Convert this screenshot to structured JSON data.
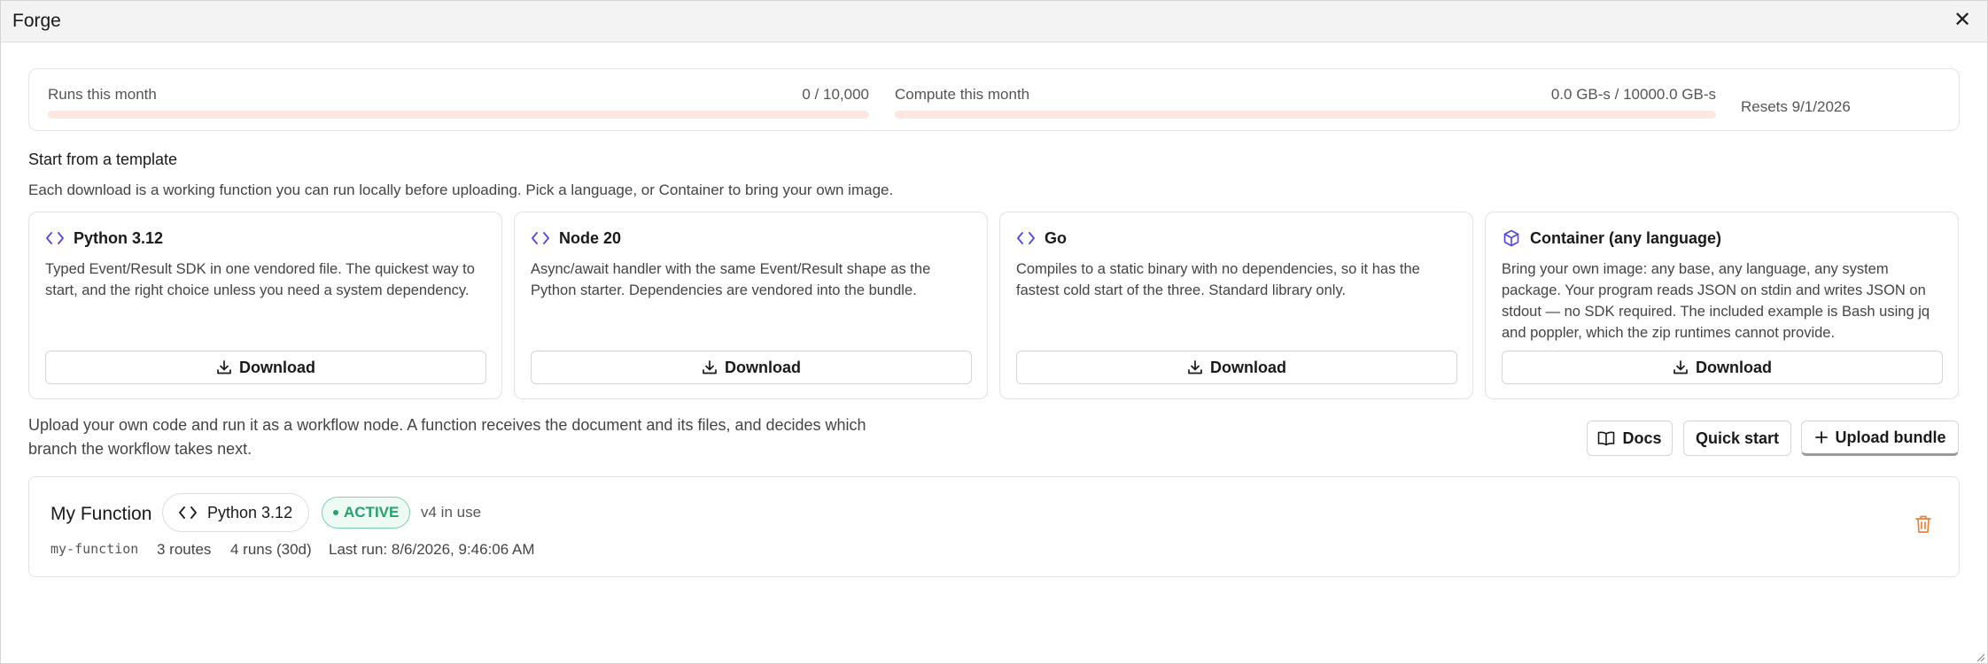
{
  "window": {
    "title": "Forge",
    "close_glyph": "✕"
  },
  "usage": {
    "runs": {
      "label": "Runs this month",
      "value": "0 / 10,000",
      "fraction": 0.0
    },
    "compute": {
      "label": "Compute this month",
      "value": "0.0 GB-s / 10000.0 GB-s",
      "fraction": 0.0
    },
    "reset": "Resets 9/1/2026",
    "colors": {
      "track": "#fde7de",
      "fill": "#f08a5d"
    }
  },
  "templates": {
    "title": "Start from a template",
    "subtitle": "Each download is a working function you can run locally before uploading. Pick a language, or Container to bring your own image.",
    "cards": [
      {
        "icon": "code-icon",
        "name": "Python 3.12",
        "desc": "Typed Event/Result SDK in one vendored file. The quickest way to start, and the right choice unless you need a system dependency.",
        "button": "Download"
      },
      {
        "icon": "code-icon",
        "name": "Node 20",
        "desc": "Async/await handler with the same Event/Result shape as the Python starter. Dependencies are vendored into the bundle.",
        "button": "Download"
      },
      {
        "icon": "code-icon",
        "name": "Go",
        "desc": "Compiles to a static binary with no dependencies, so it has the fastest cold start of the three. Standard library only.",
        "button": "Download"
      },
      {
        "icon": "cube-icon",
        "name": "Container (any language)",
        "desc": "Bring your own image: any base, any language, any system package. Your program reads JSON on stdin and writes JSON on stdout — no SDK required. The included example is Bash using jq and poppler, which the zip runtimes cannot provide.",
        "button": "Download"
      }
    ]
  },
  "upload": {
    "intro": "Upload your own code and run it as a workflow node. A function receives the document and its files, and decides which branch the workflow takes next.",
    "docs": "Docs",
    "quick_start": "Quick start",
    "upload_bundle": "Upload bundle"
  },
  "function": {
    "name": "My Function",
    "language": "Python 3.12",
    "status": "ACTIVE",
    "version": "v4 in use",
    "slug": "my-function",
    "routes": "3 routes",
    "runs": "4 runs (30d)",
    "last_run": "Last run: 8/6/2026, 9:46:06 AM",
    "colors": {
      "status": "#23a36b",
      "delete": "#e8823a",
      "accent": "#4f46e5"
    }
  }
}
